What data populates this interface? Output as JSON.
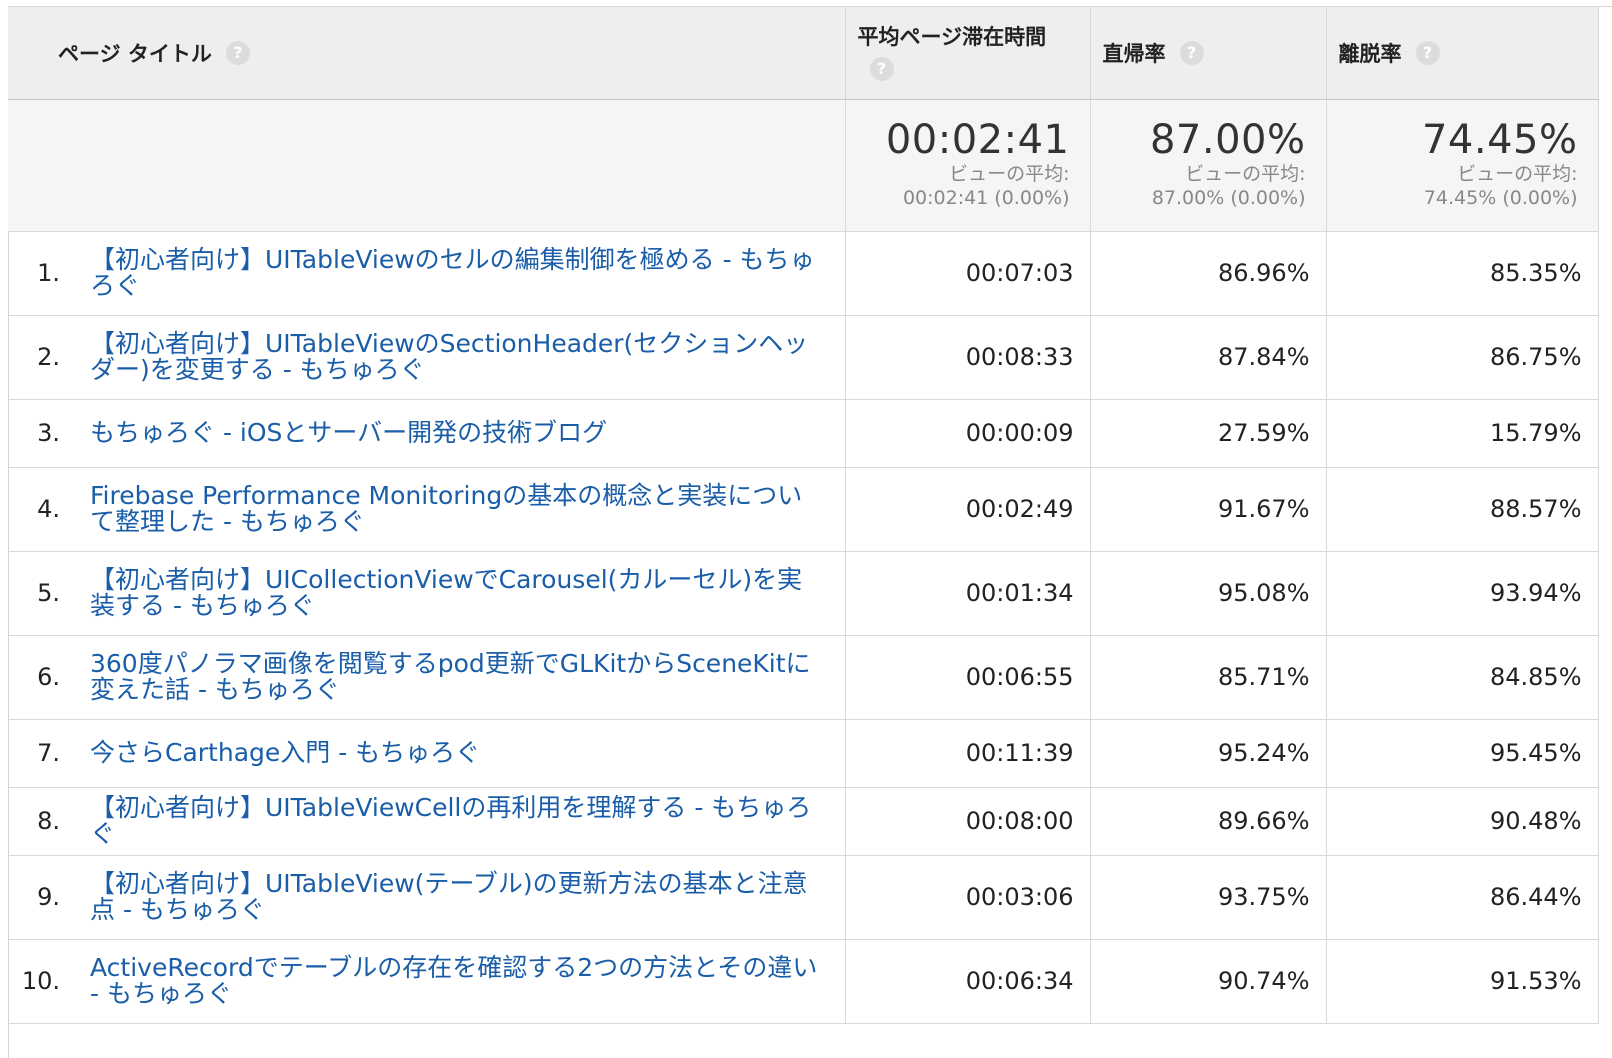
{
  "header": {
    "page_title": "ページ タイトル",
    "avg_time": "平均ページ滞在時間",
    "bounce_rate": "直帰率",
    "exit_rate": "離脱率",
    "help_glyph": "?"
  },
  "summary": {
    "avg_time": {
      "value": "00:02:41",
      "sub_label": "ビューの平均:",
      "sub_value": "00:02:41 (0.00%)"
    },
    "bounce_rate": {
      "value": "87.00%",
      "sub_label": "ビューの平均:",
      "sub_value": "87.00% (0.00%)"
    },
    "exit_rate": {
      "value": "74.45%",
      "sub_label": "ビューの平均:",
      "sub_value": "74.45% (0.00%)"
    }
  },
  "rows": [
    {
      "index": "1.",
      "title": "【初心者向け】UITableViewのセルの編集制御を極める - もちゅろぐ",
      "avg_time": "00:07:03",
      "bounce": "86.96%",
      "exit": "85.35%"
    },
    {
      "index": "2.",
      "title": "【初心者向け】UITableViewのSectionHeader(セクションヘッダー)を変更する - もちゅろぐ",
      "avg_time": "00:08:33",
      "bounce": "87.84%",
      "exit": "86.75%"
    },
    {
      "index": "3.",
      "title": "もちゅろぐ - iOSとサーバー開発の技術ブログ",
      "avg_time": "00:00:09",
      "bounce": "27.59%",
      "exit": "15.79%"
    },
    {
      "index": "4.",
      "title": "Firebase Performance Monitoringの基本の概念と実装について整理した - もちゅろぐ",
      "avg_time": "00:02:49",
      "bounce": "91.67%",
      "exit": "88.57%"
    },
    {
      "index": "5.",
      "title": "【初心者向け】UICollectionViewでCarousel(カルーセル)を実装する - もちゅろぐ",
      "avg_time": "00:01:34",
      "bounce": "95.08%",
      "exit": "93.94%"
    },
    {
      "index": "6.",
      "title": "360度パノラマ画像を閲覧するpod更新でGLKitからSceneKitに変えた話 - もちゅろぐ",
      "avg_time": "00:06:55",
      "bounce": "85.71%",
      "exit": "84.85%"
    },
    {
      "index": "7.",
      "title": "今さらCarthage入門 - もちゅろぐ",
      "avg_time": "00:11:39",
      "bounce": "95.24%",
      "exit": "95.45%"
    },
    {
      "index": "8.",
      "title": "【初心者向け】UITableViewCellの再利用を理解する - もちゅろぐ",
      "avg_time": "00:08:00",
      "bounce": "89.66%",
      "exit": "90.48%"
    },
    {
      "index": "9.",
      "title": "【初心者向け】UITableView(テーブル)の更新方法の基本と注意点 - もちゅろぐ",
      "avg_time": "00:03:06",
      "bounce": "93.75%",
      "exit": "86.44%"
    },
    {
      "index": "10.",
      "title": "ActiveRecordでテーブルの存在を確認する2つの方法とその違い - もちゅろぐ",
      "avg_time": "00:06:34",
      "bounce": "90.74%",
      "exit": "91.53%"
    }
  ],
  "colors": {
    "link": "#1a5da8",
    "header_bg": "#eeeeee",
    "summary_bg": "#f5f5f5"
  }
}
